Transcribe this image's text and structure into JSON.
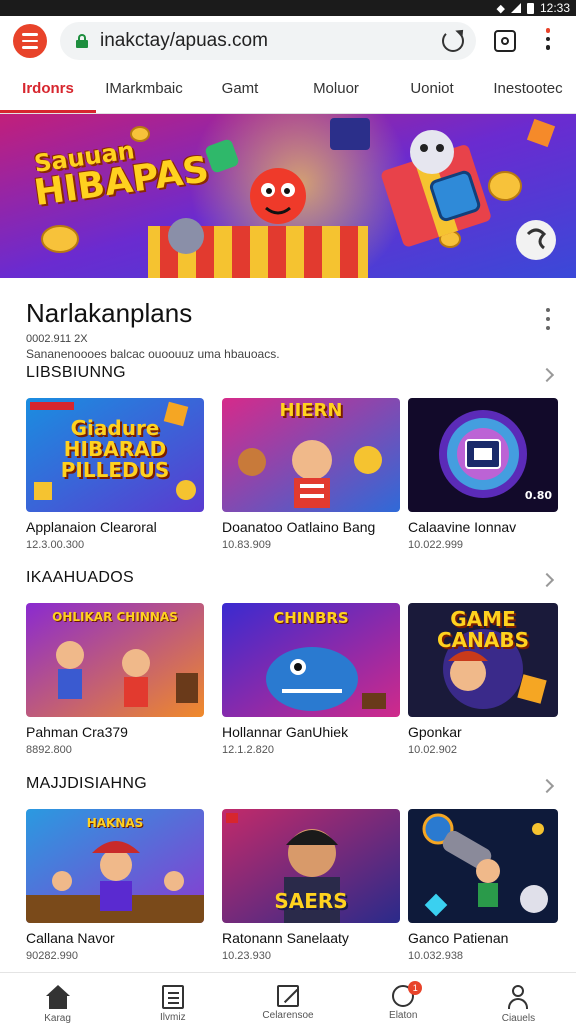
{
  "status": {
    "time": "12:33"
  },
  "browser": {
    "url": "inakctay/apuas.com",
    "icons": [
      "menu-icon",
      "lock-icon",
      "reload-icon",
      "tabs-icon",
      "more-vert-icon"
    ]
  },
  "tabs": [
    {
      "label": "Irdonrs",
      "active": true
    },
    {
      "label": "IMarkmbaic"
    },
    {
      "label": "Gamt"
    },
    {
      "label": "Moluor"
    },
    {
      "label": "Uoniot"
    },
    {
      "label": "Inestootec"
    }
  ],
  "banner": {
    "line1": "Sauuan",
    "line2": "HIBAPAS"
  },
  "page": {
    "title": "Narlakanplans",
    "meta": "0002.911 2X",
    "description": "Sananenoooes balcac ouoouuz uma hbauoacs."
  },
  "sections": [
    {
      "label": "LIBSBIUNNG",
      "cards": [
        {
          "title": "Applanaion Clearoral",
          "sub": "12.3.00.300",
          "art": "Giadure HIBARAD PILLEDUS"
        },
        {
          "title": "Doanatoo Oatlaino Bang",
          "sub": "10.83.909",
          "art": "HIERN"
        },
        {
          "title": "Calaavine Ionnav",
          "sub": "10.022.999",
          "art": "0.80"
        }
      ]
    },
    {
      "label": "IKAAHUADOS",
      "cards": [
        {
          "title": "Pahman Cra379",
          "sub": "8892.800",
          "art": "OHLIKAR CHINNAS"
        },
        {
          "title": "Hollannar GanUhiek",
          "sub": "12.1.2.820",
          "art": "CHINBRS"
        },
        {
          "title": "Gponkar",
          "sub": "10.02.902",
          "art": "GAME CANABS"
        }
      ]
    },
    {
      "label": "MAJJDISIAHNG",
      "cards": [
        {
          "title": "Callana Navor",
          "sub": "90282.990",
          "art": "HAKNAS"
        },
        {
          "title": "Ratonann Sanelaaty",
          "sub": "10.23.930",
          "art": "SAERS"
        },
        {
          "title": "Ganco Patienan",
          "sub": "10.032.938",
          "art": ""
        }
      ]
    }
  ],
  "bottom_nav": [
    {
      "label": "Karag",
      "icon": "home-icon"
    },
    {
      "label": "Ilvmiz",
      "icon": "list-icon"
    },
    {
      "label": "Celarensoe",
      "icon": "edit-icon"
    },
    {
      "label": "Elaton",
      "icon": "bell-icon",
      "badge": "1"
    },
    {
      "label": "Ciauels",
      "icon": "user-icon"
    }
  ]
}
